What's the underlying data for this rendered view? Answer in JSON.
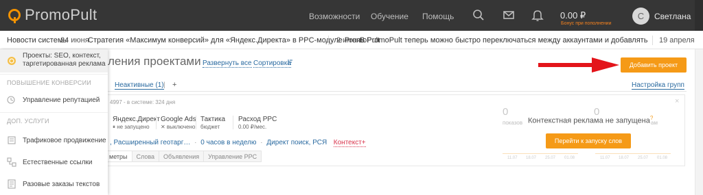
{
  "app": {
    "logo_text": "PromoPult",
    "accent": "#f59a17",
    "topbar_bg": "#363636"
  },
  "nav": {
    "items": [
      {
        "label": "Возможности"
      },
      {
        "label": "Обучение"
      },
      {
        "label": "Помощь"
      }
    ],
    "icons": [
      "search-icon",
      "mail-icon",
      "bell-icon"
    ],
    "balance": "0.00 ₽",
    "bonus": "Бонус при пополнении",
    "user": {
      "avatar_letter": "С",
      "name": "Светлана"
    }
  },
  "ticker": {
    "label": "Новости системы",
    "items": [
      {
        "date": "24 июня",
        "text": "Стратегия «Максимум конверсий» для «Яндекс.Директа» в PPC-модуле PromoPult"
      },
      {
        "date": "2 июня",
        "text": "В PromoPult теперь можно быстро переключаться между аккаунтами и добавлять новых пользователей"
      },
      {
        "date": "19 апреля",
        "text": ""
      }
    ]
  },
  "sidebar": {
    "active": {
      "label_line1": "Проекты: SEO, контекст,",
      "label_line2": "таргетированная реклама"
    },
    "sections": [
      {
        "title": "ПОВЫШЕНИЕ КОНВЕРСИИ",
        "items": [
          {
            "label": "Управление репутацией",
            "icon": "reputation-icon"
          }
        ]
      },
      {
        "title": "ДОП. УСЛУГИ",
        "items": [
          {
            "label": "Трафиковое продвижение",
            "icon": "traffic-icon"
          },
          {
            "label": "Естественные ссылки",
            "icon": "links-icon"
          },
          {
            "label": "Разовые заказы текстов",
            "icon": "texts-icon"
          }
        ]
      }
    ]
  },
  "main": {
    "title": "ления проектами",
    "expand_all": "Развернуть все",
    "sort": "Сортировка",
    "add_project": "Добавить проект",
    "tabs": {
      "inactive": "Неактивные (1)",
      "sep": "|",
      "plus": "+"
    },
    "group_settings": "Настройка групп"
  },
  "card": {
    "id_text": "4997 - в системе: 324 дня",
    "metrics": [
      {
        "title": "Яндекс.Директ",
        "sub": "⏸ не запущено"
      },
      {
        "title": "Google Ads",
        "sub": "✕ выключено"
      },
      {
        "title": "Тактика",
        "sub": "бюджет"
      },
      {
        "title": "Расход PPC",
        "sub": "0.00 ₽/мес."
      }
    ],
    "links": {
      "geo": ", Расширенный геотарг…",
      "hours": "0 часов в неделю",
      "search": "Директ поиск, РСЯ",
      "context": "Контекст+",
      "dash": "·"
    },
    "subtabs": [
      "метры",
      "Слова",
      "Объявления",
      "Управление PPC"
    ],
    "stats": [
      {
        "num": "0",
        "label": "показов"
      },
      {
        "num": "0",
        "label": "ам"
      }
    ],
    "context_msg": "Контекстная реклама не запущена",
    "context_sup": "?",
    "go_button": "Перейти к запуску слов",
    "close": "×",
    "spark_ticks_left": [
      "11.07",
      "18.07",
      "25.07",
      "01.08"
    ],
    "spark_ticks_right": [
      "11.07",
      "18.07",
      "25.07",
      "01.08"
    ]
  }
}
